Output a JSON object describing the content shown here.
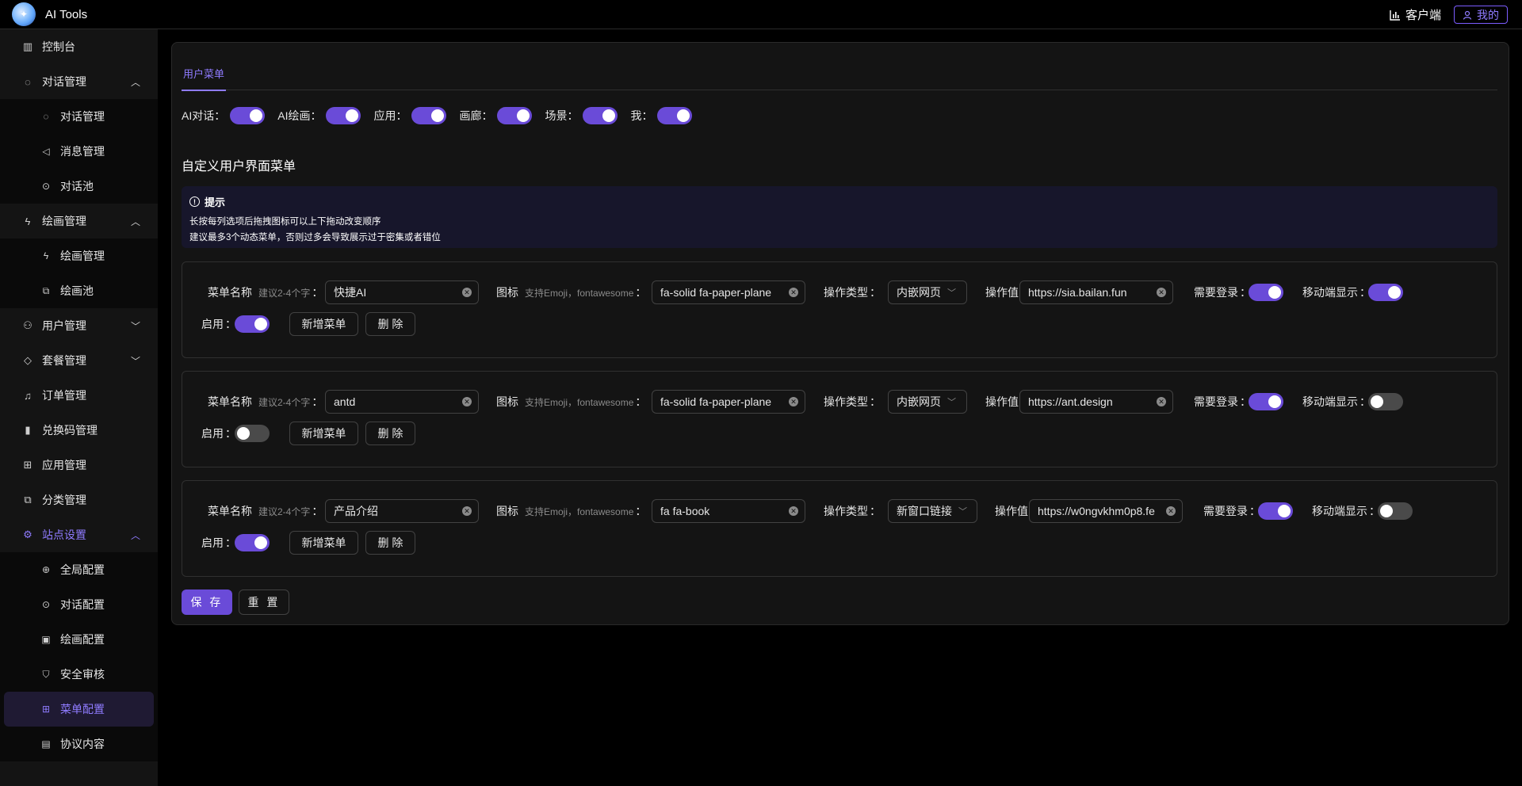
{
  "header": {
    "title": "AI Tools",
    "client_label": "客户端",
    "mine_label": "我的"
  },
  "sidebar": {
    "dashboard": "控制台",
    "chat_mgmt": "对话管理",
    "chat_mgmt_items": [
      "对话管理",
      "消息管理",
      "对话池"
    ],
    "draw_mgmt": "绘画管理",
    "draw_mgmt_items": [
      "绘画管理",
      "绘画池"
    ],
    "user_mgmt": "用户管理",
    "package_mgmt": "套餐管理",
    "order_mgmt": "订单管理",
    "code_mgmt": "兑换码管理",
    "app_mgmt": "应用管理",
    "category_mgmt": "分类管理",
    "site_settings": "站点设置",
    "site_settings_items": [
      "全局配置",
      "对话配置",
      "绘画配置",
      "安全审核",
      "菜单配置",
      "协议内容"
    ]
  },
  "tabs": {
    "user_menu": "用户菜单"
  },
  "toggles": {
    "ai_chat": {
      "label": "AI对话",
      "on": true
    },
    "ai_draw": {
      "label": "AI绘画",
      "on": true
    },
    "apps": {
      "label": "应用",
      "on": true
    },
    "gallery": {
      "label": "画廊",
      "on": true
    },
    "scene": {
      "label": "场景",
      "on": true
    },
    "me": {
      "label": "我",
      "on": true
    }
  },
  "section_title": "自定义用户界面菜单",
  "alert": {
    "title": "提示",
    "line1": "长按每列选项后拖拽图标可以上下拖动改变顺序",
    "line2": "建议最多3个动态菜单，否则过多会导致展示过于密集或者错位"
  },
  "labels": {
    "menu_name": "菜单名称",
    "menu_name_hint": "建议2-4个字",
    "icon": "图标",
    "icon_hint": "支持Emoji，fontawesome",
    "action_type": "操作类型",
    "action_value": "操作值",
    "need_login": "需要登录",
    "mobile_show": "移动端显示",
    "enabled": "启用",
    "add_menu": "新增菜单",
    "delete": "删 除"
  },
  "menus": [
    {
      "name": "快捷AI",
      "icon": "fa-solid fa-paper-plane",
      "type": "内嵌网页",
      "value": "https://sia.bailan.fun",
      "need_login": true,
      "mobile": true,
      "enabled": true
    },
    {
      "name": "antd",
      "icon": "fa-solid fa-paper-plane",
      "type": "内嵌网页",
      "value": "https://ant.design",
      "need_login": true,
      "mobile": false,
      "enabled": false
    },
    {
      "name": "产品介绍",
      "icon": "fa fa-book",
      "type": "新窗口链接",
      "value": "https://w0ngvkhm0p8.fe",
      "need_login": true,
      "mobile": false,
      "enabled": true
    }
  ],
  "actions": {
    "save": "保 存",
    "reset": "重 置"
  },
  "colors": {
    "accent": "#6a4bd8",
    "accent_text": "#8f7bff",
    "bg": "#000000",
    "panel": "#141414"
  }
}
